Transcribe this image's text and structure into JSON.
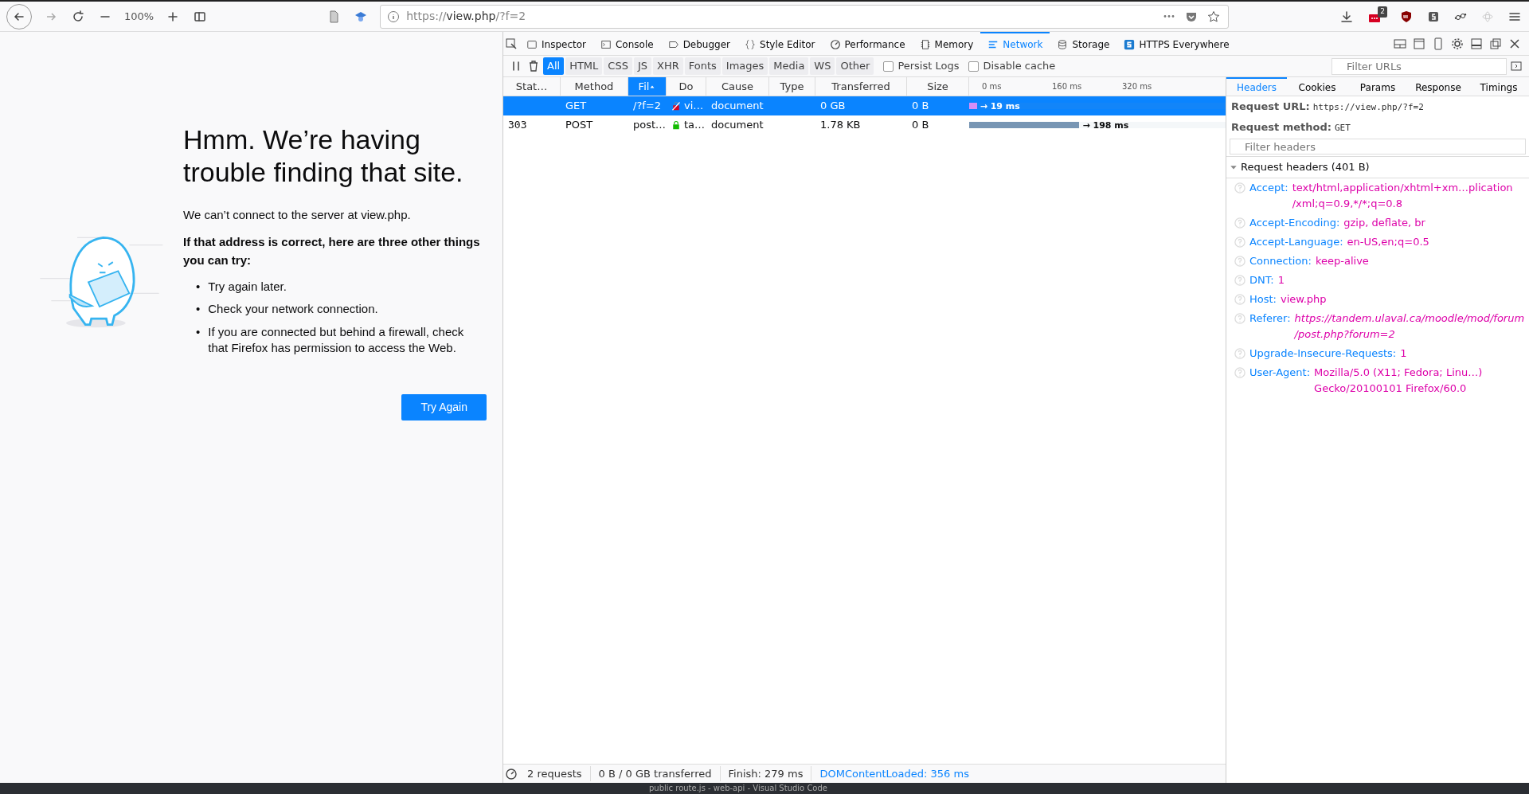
{
  "toolbar": {
    "zoom": "100%",
    "url": {
      "scheme": "https://",
      "host": "view.php",
      "path": "/?f=2"
    },
    "badge": "2"
  },
  "error_page": {
    "title": "Hmm. We’re having trouble finding that site.",
    "message": "We can’t connect to the server at view.php.",
    "suggestion_heading": "If that address is correct, here are three other things you can try:",
    "suggestions": [
      {
        "marker": "•",
        "text": "Try again later."
      },
      {
        "marker": "•",
        "text": "Check your network connection."
      },
      {
        "marker": "•",
        "text": "If you are connected but behind a firewall, check that Firefox has permission to access the Web."
      }
    ],
    "button": "Try Again"
  },
  "devtools": {
    "tabs": [
      {
        "label": "Inspector",
        "selected": false
      },
      {
        "label": "Console",
        "selected": false
      },
      {
        "label": "Debugger",
        "selected": false
      },
      {
        "label": "Style Editor",
        "selected": false
      },
      {
        "label": "Performance",
        "selected": false
      },
      {
        "label": "Memory",
        "selected": false
      },
      {
        "label": "Network",
        "selected": true
      },
      {
        "label": "Storage",
        "selected": false
      },
      {
        "label": "HTTPS Everywhere",
        "selected": false
      }
    ],
    "filters": [
      {
        "label": "All",
        "selected": true
      },
      {
        "label": "HTML",
        "selected": false
      },
      {
        "label": "CSS",
        "selected": false
      },
      {
        "label": "JS",
        "selected": false
      },
      {
        "label": "XHR",
        "selected": false
      },
      {
        "label": "Fonts",
        "selected": false
      },
      {
        "label": "Images",
        "selected": false
      },
      {
        "label": "Media",
        "selected": false
      },
      {
        "label": "WS",
        "selected": false
      },
      {
        "label": "Other",
        "selected": false
      }
    ],
    "checkboxes": [
      {
        "label": "Persist Logs",
        "checked": false
      },
      {
        "label": "Disable cache",
        "checked": false
      }
    ],
    "filter_placeholder": "Filter URLs",
    "columns": [
      {
        "label": "Stat…",
        "selected": false
      },
      {
        "label": "Method",
        "selected": false
      },
      {
        "label": "Fil",
        "selected": true
      },
      {
        "label": "Do",
        "selected": false
      },
      {
        "label": "Cause",
        "selected": false
      },
      {
        "label": "Type",
        "selected": false
      },
      {
        "label": "Transferred",
        "selected": false
      },
      {
        "label": "Size",
        "selected": false
      }
    ],
    "waterfall_ticks": [
      "0 ms",
      "160 ms",
      "320 ms"
    ],
    "rows": [
      {
        "status": "",
        "method": "GET",
        "file": "/?f=2",
        "domain": "vi…",
        "kind": "insecure",
        "cause": "document",
        "type": "",
        "transferred": "0 GB",
        "size": "0 B",
        "selected": true,
        "timing": {
          "level": 0.03,
          "label": "→ 19 ms"
        }
      },
      {
        "status": "303",
        "method": "POST",
        "file": "post.…",
        "domain": "ta…",
        "kind": "secure",
        "cause": "document",
        "type": "",
        "transferred": "1.78 KB",
        "size": "0 B",
        "selected": false,
        "timing": {
          "level": 0.43,
          "label": "→ 198 ms"
        }
      }
    ]
  },
  "details": {
    "tabs": [
      {
        "label": "Headers",
        "selected": true
      },
      {
        "label": "Cookies",
        "selected": false
      },
      {
        "label": "Params",
        "selected": false
      },
      {
        "label": "Response",
        "selected": false
      },
      {
        "label": "Timings",
        "selected": false
      }
    ],
    "request_url": {
      "label": "Request URL:",
      "value": "https://view.php/?f=2"
    },
    "request_method": {
      "label": "Request method:",
      "value": "GET"
    },
    "filter_placeholder": "Filter headers",
    "section": {
      "title": "Request headers (401 B)",
      "expanded": true
    },
    "headers": [
      {
        "name": "Accept:",
        "value": "text/html,application/xhtml+xm…plication /xml;q=0.9,*/*;q=0.8",
        "kind": "text"
      },
      {
        "name": "Accept-Encoding:",
        "value": "gzip, deflate, br",
        "kind": "text"
      },
      {
        "name": "Accept-Language:",
        "value": "en-US,en;q=0.5",
        "kind": "text"
      },
      {
        "name": "Connection:",
        "value": "keep-alive",
        "kind": "text"
      },
      {
        "name": "DNT:",
        "value": "1",
        "kind": "text"
      },
      {
        "name": "Host:",
        "value": "view.php",
        "kind": "text"
      },
      {
        "name": "Referer:",
        "value": "https://tandem.ulaval.ca/moodle/mod/forum /post.php?forum=2",
        "kind": "link"
      },
      {
        "name": "Upgrade-Insecure-Requests:",
        "value": "1",
        "kind": "text"
      },
      {
        "name": "User-Agent:",
        "value": "Mozilla/5.0 (X11; Fedora; Linu…) Gecko/20100101 Firefox/60.0",
        "kind": "text"
      }
    ]
  },
  "status_bar": {
    "items": [
      "2 requests",
      "0 B / 0 GB transferred",
      "Finish: 279 ms"
    ],
    "link": "DOMContentLoaded: 356 ms"
  },
  "taskbar": {
    "title": "public route.js - web-api - Visual Studio Code"
  }
}
